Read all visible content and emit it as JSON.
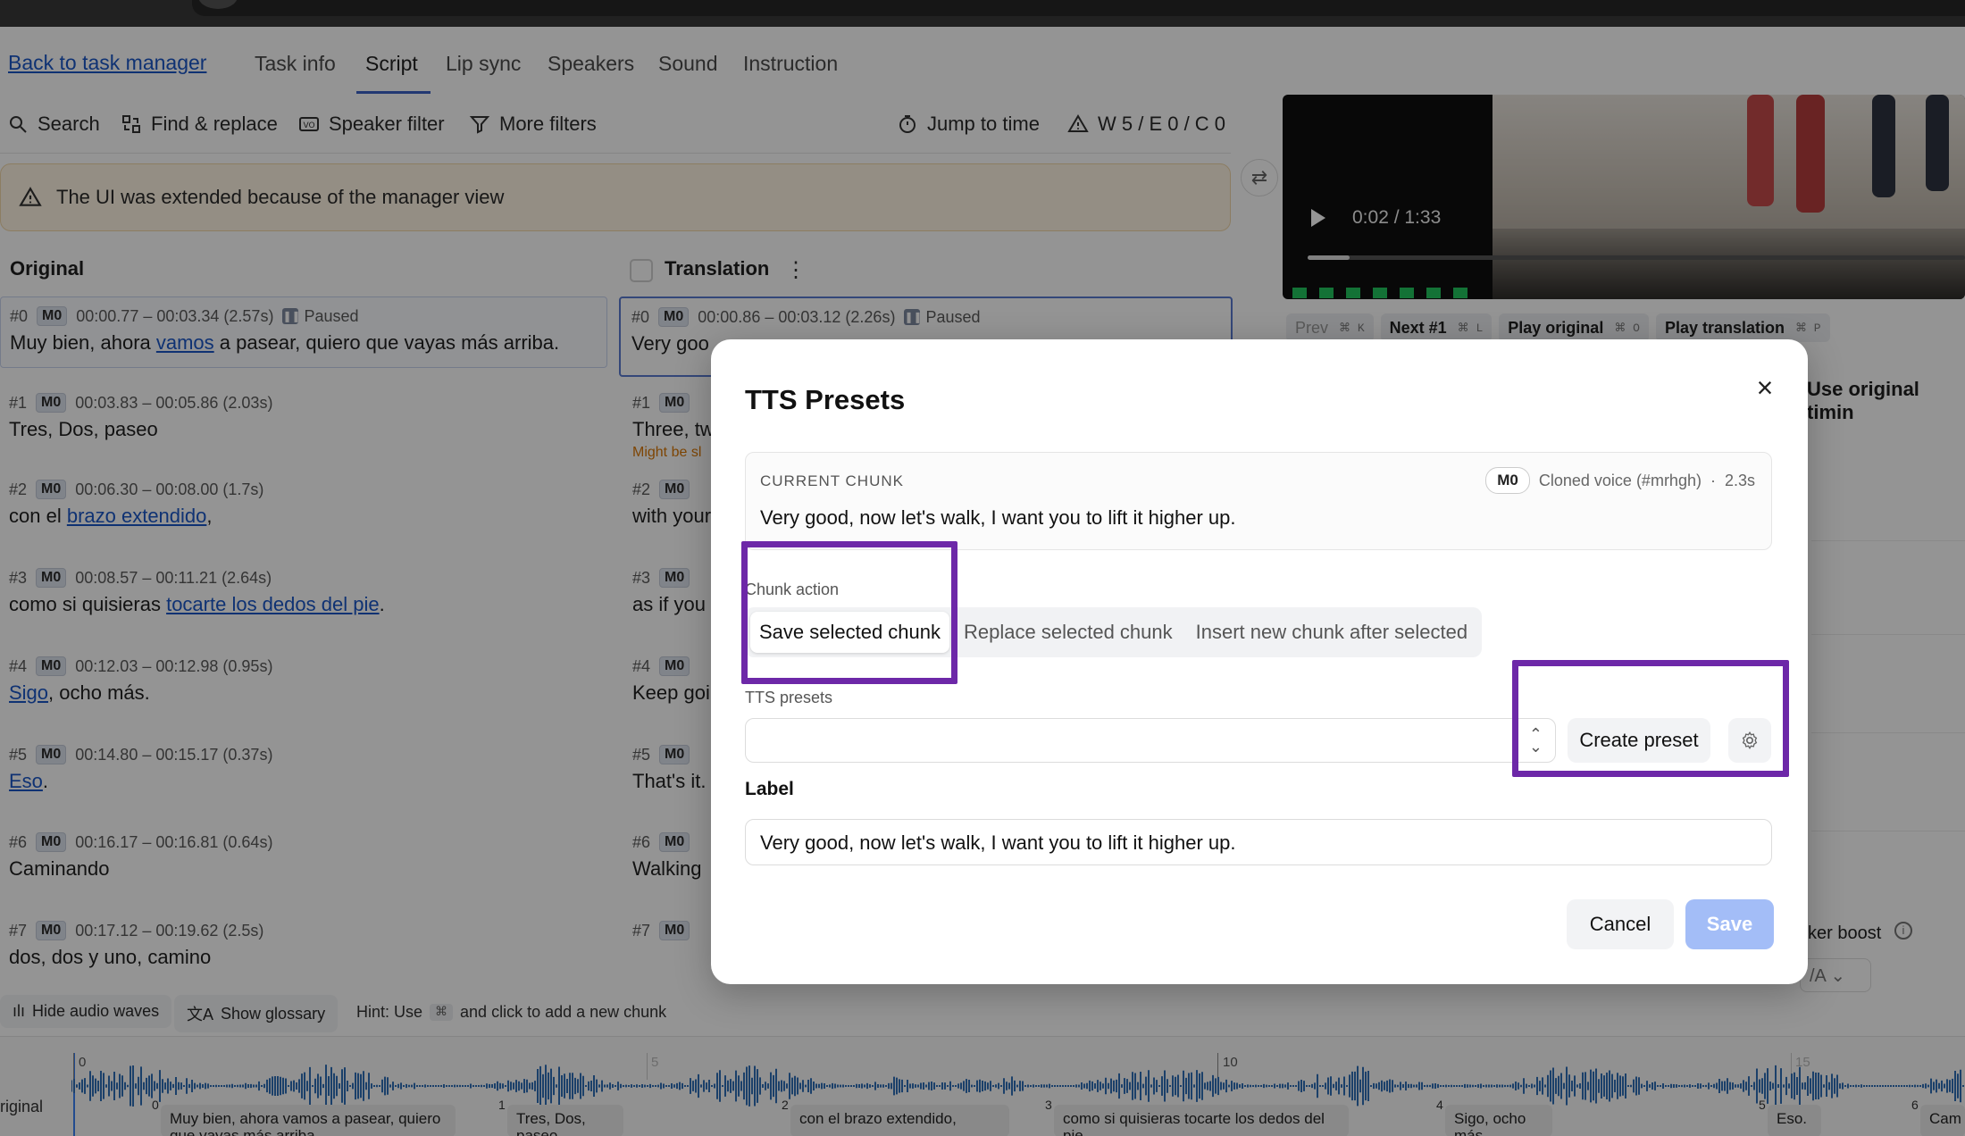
{
  "nav": {
    "back_link": "Back to task manager",
    "tabs": [
      "Task info",
      "Script",
      "Lip sync",
      "Speakers",
      "Sound",
      "Instruction"
    ],
    "active_tab": "Script"
  },
  "toolbar": {
    "search": "Search",
    "find_replace": "Find & replace",
    "speaker_filter": "Speaker filter",
    "more_filters": "More filters",
    "jump_to_time": "Jump to time",
    "warnings": "W 5 / E 0 / C 0"
  },
  "warning_banner": "The UI was extended because of the manager view",
  "columns": {
    "original": "Original",
    "translation": "Translation"
  },
  "original_rows": [
    {
      "id": "#0",
      "speaker": "M0",
      "time": "00:00.77 – 00:03.34 (2.57s)",
      "status": "Paused",
      "pre": "Muy bien, ahora ",
      "link": "vamos",
      "post": " a pasear, quiero que vayas más arriba."
    },
    {
      "id": "#1",
      "speaker": "M0",
      "time": "00:03.83 – 00:05.86 (2.03s)",
      "pre": "Tres, Dos, paseo",
      "link": "",
      "post": ""
    },
    {
      "id": "#2",
      "speaker": "M0",
      "time": "00:06.30 – 00:08.00 (1.7s)",
      "pre": "con el ",
      "link": "brazo extendido",
      "post": ","
    },
    {
      "id": "#3",
      "speaker": "M0",
      "time": "00:08.57 – 00:11.21 (2.64s)",
      "pre": "como si quisieras ",
      "link": "tocarte los dedos del pie",
      "post": "."
    },
    {
      "id": "#4",
      "speaker": "M0",
      "time": "00:12.03 – 00:12.98 (0.95s)",
      "pre": "",
      "link": "Sigo",
      "post": ", ocho más."
    },
    {
      "id": "#5",
      "speaker": "M0",
      "time": "00:14.80 – 00:15.17 (0.37s)",
      "pre": "",
      "link": "Eso",
      "post": "."
    },
    {
      "id": "#6",
      "speaker": "M0",
      "time": "00:16.17 – 00:16.81 (0.64s)",
      "pre": "Caminando",
      "link": "",
      "post": ""
    },
    {
      "id": "#7",
      "speaker": "M0",
      "time": "00:17.12 – 00:19.62 (2.5s)",
      "pre": "dos, dos y uno, camino",
      "link": "",
      "post": ""
    }
  ],
  "translation_rows": [
    {
      "id": "#0",
      "speaker": "M0",
      "time": "00:00.86 – 00:03.12 (2.26s)",
      "status": "Paused",
      "text": "Very goo"
    },
    {
      "id": "#1",
      "speaker": "M0",
      "text": "Three, tw",
      "note": "Might be sl"
    },
    {
      "id": "#2",
      "speaker": "M0",
      "text": "with your"
    },
    {
      "id": "#3",
      "speaker": "M0",
      "text": "as if you"
    },
    {
      "id": "#4",
      "speaker": "M0",
      "text": "Keep goi"
    },
    {
      "id": "#5",
      "speaker": "M0",
      "text": "That's it."
    },
    {
      "id": "#6",
      "speaker": "M0",
      "text": "Walking"
    },
    {
      "id": "#7",
      "speaker": "M0",
      "text": ""
    }
  ],
  "video": {
    "time": "0:02 / 1:33",
    "progress": 0.02
  },
  "player_controls": [
    {
      "label": "Prev",
      "kbd": "⌘ K",
      "disabled": true
    },
    {
      "label": "Next #1",
      "kbd": "⌘ L",
      "disabled": false
    },
    {
      "label": "Play original",
      "kbd": "⌘ O",
      "disabled": false
    },
    {
      "label": "Play translation",
      "kbd": "⌘ P",
      "disabled": false
    }
  ],
  "right_panel": {
    "use_original_timing": "Use original timin",
    "speaker_boost": "ker boost",
    "speaker_select": "/A"
  },
  "bottom_bar": {
    "hide_waves": "Hide audio waves",
    "show_glossary": "Show glossary",
    "hint_pre": "Hint: Use",
    "hint_key": "⌘",
    "hint_post": "and click to add a new chunk"
  },
  "timeline": {
    "track_label": "riginal",
    "ticks": [
      "0",
      "5",
      "10",
      "15"
    ],
    "segments": [
      {
        "n": "0",
        "text": "Muy bien, ahora vamos a pasear, quiero que vayas más arriba."
      },
      {
        "n": "1",
        "text": "Tres, Dos, paseo"
      },
      {
        "n": "2",
        "text": "con el brazo extendido,"
      },
      {
        "n": "3",
        "text": "como si quisieras tocarte los dedos del pie."
      },
      {
        "n": "4",
        "text": "Sigo, ocho más."
      },
      {
        "n": "5",
        "text": "Eso."
      },
      {
        "n": "6",
        "text": "Cam"
      }
    ]
  },
  "modal": {
    "title": "TTS Presets",
    "current_chunk_label": "CURRENT CHUNK",
    "speaker": "M0",
    "voice": "Cloned voice (#mrhgh)",
    "duration": "2.3s",
    "chunk_text": "Very good, now let's walk, I want you to lift it higher up.",
    "chunk_action_label": "Chunk action",
    "chunk_actions": [
      "Save selected chunk",
      "Replace selected chunk",
      "Insert new chunk after selected"
    ],
    "selected_action": "Save selected chunk",
    "tts_presets_label": "TTS presets",
    "preset_value": "",
    "create_preset": "Create preset",
    "label_heading": "Label",
    "label_value": "Very good, now let's walk, I want you to lift it higher up.",
    "cancel": "Cancel",
    "save": "Save"
  },
  "colors": {
    "accent": "#3b61c5",
    "highlight_box": "#6d28a8",
    "save_disabled": "#a3bdf7",
    "wave": "#2f6fb7"
  }
}
